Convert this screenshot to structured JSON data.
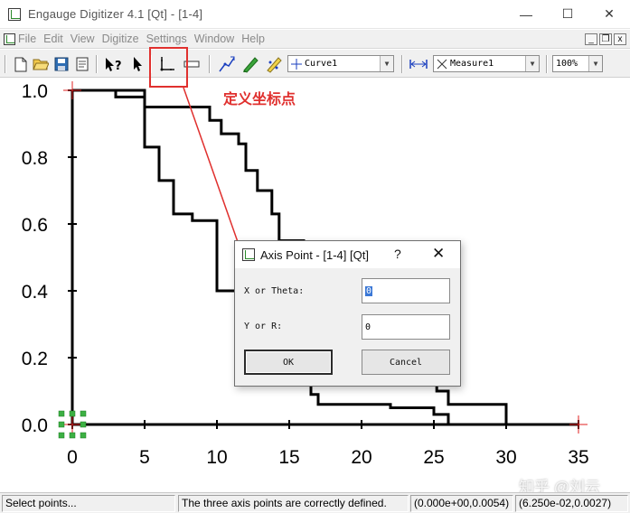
{
  "window": {
    "title": "Engauge Digitizer 4.1 [Qt] - [1-4]",
    "controls": {
      "minimize": "—",
      "maximize": "☐",
      "close": "✕"
    }
  },
  "menubar": {
    "items": [
      "File",
      "Edit",
      "View",
      "Digitize",
      "Settings",
      "Window",
      "Help"
    ],
    "mdi": {
      "minimize": "_",
      "restore": "❐",
      "close": "x"
    }
  },
  "toolbar": {
    "curve_combo": "Curve1",
    "measure_combo": "Measure1",
    "zoom_combo": "100%"
  },
  "annotation": {
    "text": "定义坐标点",
    "color": "#e0302e"
  },
  "chart_data": {
    "type": "line",
    "xlim": [
      0,
      35
    ],
    "ylim": [
      0,
      1.0
    ],
    "x_ticks": [
      "0",
      "5",
      "10",
      "15",
      "20",
      "25",
      "30",
      "35"
    ],
    "y_ticks": [
      "0.0",
      "0.2",
      "0.4",
      "0.6",
      "0.8",
      "1.0"
    ],
    "grid": false,
    "series": [
      {
        "points": [
          [
            0,
            1.0
          ],
          [
            5,
            1.0
          ],
          [
            5,
            0.83
          ],
          [
            6,
            0.83
          ],
          [
            6,
            0.73
          ],
          [
            7,
            0.73
          ],
          [
            7,
            0.63
          ],
          [
            8.3,
            0.63
          ],
          [
            8.3,
            0.61
          ],
          [
            10,
            0.61
          ],
          [
            10,
            0.4
          ],
          [
            11.5,
            0.4
          ],
          [
            11.5,
            0.39
          ],
          [
            12,
            0.39
          ],
          [
            12,
            0.36
          ],
          [
            14.8,
            0.36
          ],
          [
            14.8,
            0.2
          ],
          [
            15,
            0.2
          ],
          [
            15,
            0.12
          ],
          [
            16.5,
            0.12
          ],
          [
            16.5,
            0.09
          ],
          [
            17,
            0.09
          ],
          [
            17,
            0.06
          ],
          [
            22,
            0.06
          ],
          [
            22,
            0.05
          ],
          [
            25,
            0.05
          ],
          [
            25,
            0.03
          ],
          [
            26,
            0.03
          ],
          [
            26,
            0.0
          ]
        ]
      },
      {
        "points": [
          [
            0,
            1.0
          ],
          [
            3,
            1.0
          ],
          [
            3,
            0.98
          ],
          [
            5,
            0.98
          ],
          [
            5,
            0.95
          ],
          [
            9.5,
            0.95
          ],
          [
            9.5,
            0.91
          ],
          [
            10.3,
            0.91
          ],
          [
            10.3,
            0.87
          ],
          [
            11.5,
            0.87
          ],
          [
            11.5,
            0.84
          ],
          [
            12,
            0.84
          ],
          [
            12,
            0.76
          ],
          [
            12.8,
            0.76
          ],
          [
            12.8,
            0.7
          ],
          [
            13.8,
            0.7
          ],
          [
            13.8,
            0.63
          ],
          [
            14.3,
            0.63
          ],
          [
            14.3,
            0.55
          ],
          [
            16,
            0.55
          ],
          [
            16,
            0.49
          ],
          [
            17.5,
            0.49
          ],
          [
            17.5,
            0.35
          ],
          [
            19,
            0.35
          ],
          [
            19,
            0.27
          ],
          [
            20,
            0.27
          ],
          [
            20,
            0.22
          ],
          [
            22,
            0.22
          ],
          [
            22,
            0.17
          ],
          [
            24.3,
            0.17
          ],
          [
            24.3,
            0.14
          ],
          [
            25.2,
            0.14
          ],
          [
            25.2,
            0.1
          ],
          [
            26,
            0.1
          ],
          [
            26,
            0.06
          ],
          [
            30,
            0.06
          ],
          [
            30,
            0.0
          ]
        ]
      }
    ]
  },
  "dialog": {
    "title": "Axis Point - [1-4] [Qt]",
    "help": "?",
    "close": "✕",
    "x_label": "X or Theta:",
    "x_value": "0",
    "y_label": "Y or R:",
    "y_value": "0",
    "ok": "OK",
    "cancel": "Cancel"
  },
  "statusbar": {
    "mode": "Select points...",
    "message": "The three axis points are correctly defined.",
    "coords_graph": "(0.000e+00,0.0054)",
    "coords_screen": "(6.250e-02,0.0027)"
  },
  "watermark": "知乎 @刘云"
}
